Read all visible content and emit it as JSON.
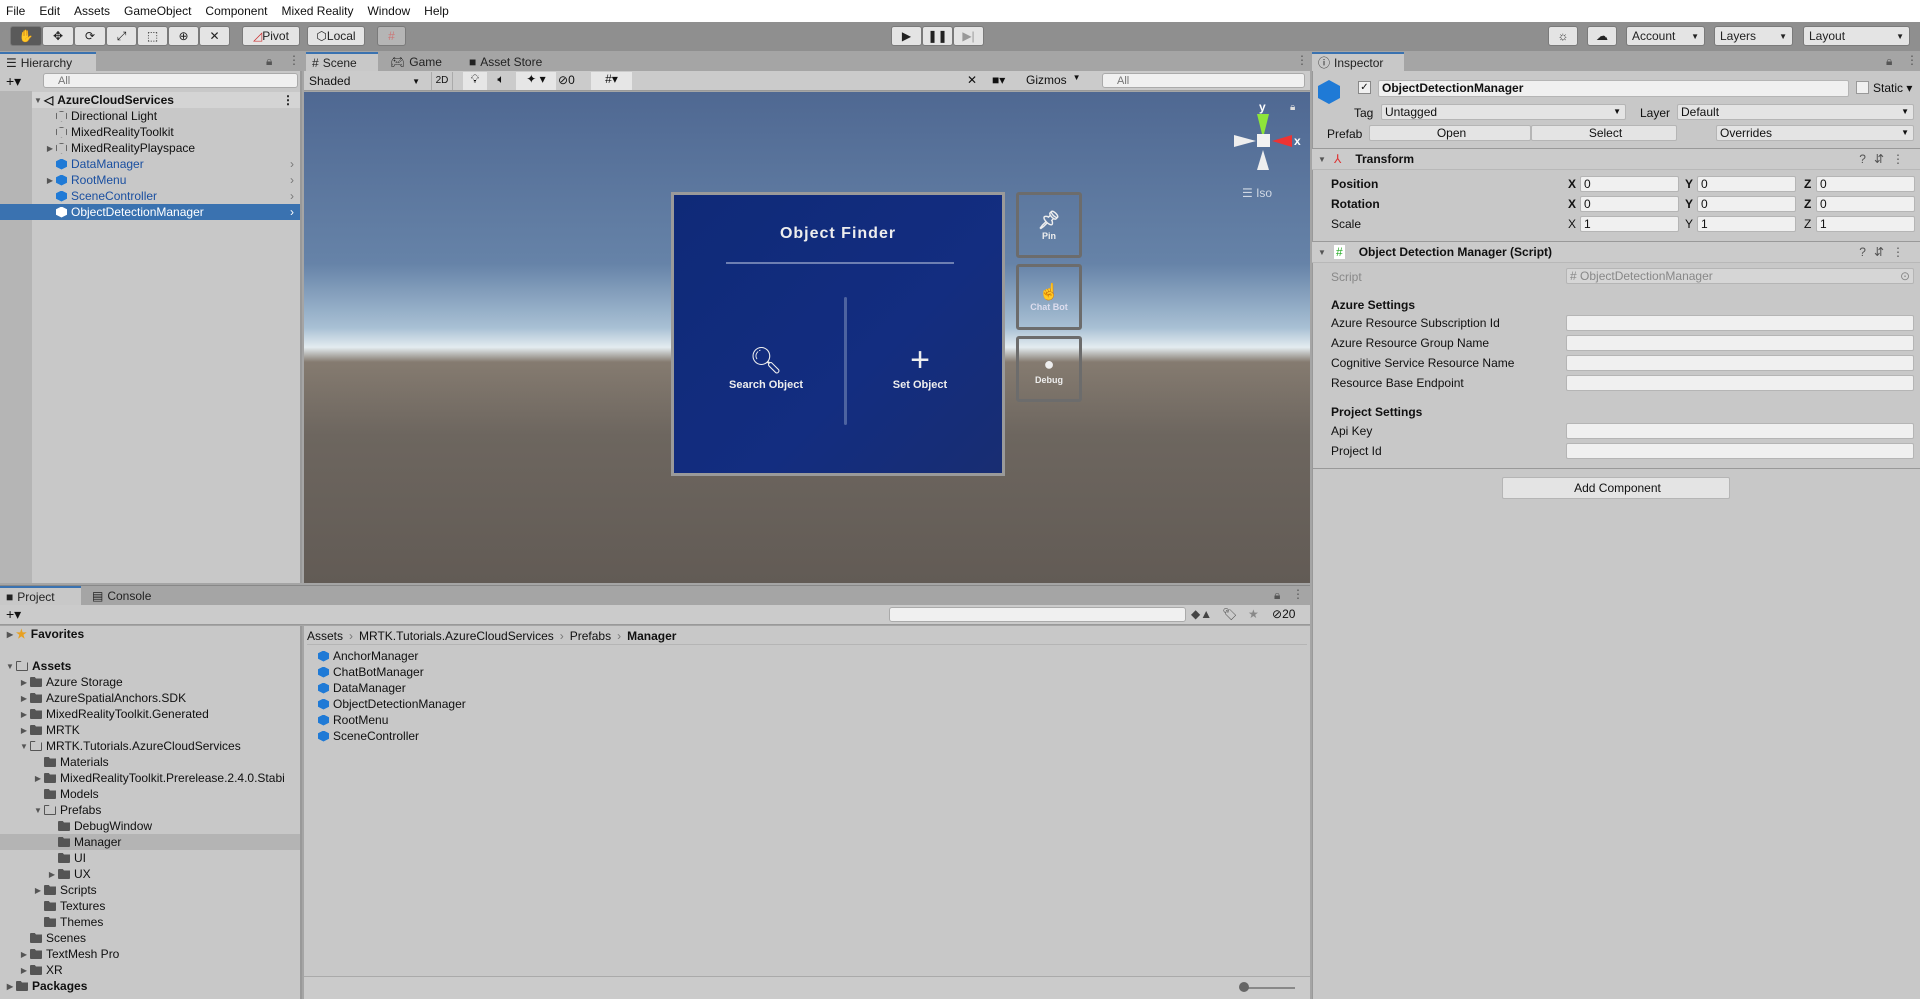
{
  "menu": [
    "File",
    "Edit",
    "Assets",
    "GameObject",
    "Component",
    "Mixed Reality",
    "Window",
    "Help"
  ],
  "toolbar": {
    "pivot": "Pivot",
    "local": "Local",
    "account": "Account",
    "layers": "Layers",
    "layout": "Layout"
  },
  "hierarchy": {
    "tab": "Hierarchy",
    "search_placeholder": "All",
    "scene": "AzureCloudServices",
    "items": [
      {
        "label": "Directional Light",
        "type": "go",
        "expand": false
      },
      {
        "label": "MixedRealityToolkit",
        "type": "go",
        "expand": false
      },
      {
        "label": "MixedRealityPlayspace",
        "type": "go",
        "expand": true
      },
      {
        "label": "DataManager",
        "type": "prefab",
        "expand": false
      },
      {
        "label": "RootMenu",
        "type": "prefab",
        "expand": true
      },
      {
        "label": "SceneController",
        "type": "prefab",
        "expand": false
      },
      {
        "label": "ObjectDetectionManager",
        "type": "prefab",
        "expand": false,
        "selected": true
      }
    ]
  },
  "scene": {
    "tabs": [
      "Scene",
      "Game",
      "Asset Store"
    ],
    "shading": "Shaded",
    "mode2d": "2D",
    "hidden_count": "0",
    "gizmos": "Gizmos",
    "search_placeholder": "All",
    "axis_y": "y",
    "axis_x": "x",
    "projection": "Iso",
    "panel": {
      "title": "Object Finder",
      "search": "Search Object",
      "set": "Set Object"
    },
    "side_buttons": [
      "Pin",
      "Chat Bot",
      "Debug"
    ]
  },
  "inspector": {
    "tab": "Inspector",
    "object_name": "ObjectDetectionManager",
    "static": "Static",
    "tag_label": "Tag",
    "tag": "Untagged",
    "layer_label": "Layer",
    "layer": "Default",
    "prefab_label": "Prefab",
    "open": "Open",
    "select": "Select",
    "overrides": "Overrides",
    "transform": {
      "title": "Transform",
      "rows": [
        {
          "label": "Position",
          "x": "0",
          "y": "0",
          "z": "0"
        },
        {
          "label": "Rotation",
          "x": "0",
          "y": "0",
          "z": "0"
        },
        {
          "label": "Scale",
          "x": "1",
          "y": "1",
          "z": "1"
        }
      ]
    },
    "script_comp": {
      "title": "Object Detection Manager (Script)",
      "script_label": "Script",
      "script_value": "ObjectDetectionManager",
      "azure_header": "Azure Settings",
      "azure_fields": [
        "Azure Resource Subscription Id",
        "Azure Resource Group Name",
        "Cognitive Service Resource Name",
        "Resource Base Endpoint"
      ],
      "project_header": "Project Settings",
      "project_fields": [
        "Api Key",
        "Project Id"
      ]
    },
    "add_component": "Add Component"
  },
  "project": {
    "tabs": [
      "Project",
      "Console"
    ],
    "hidden_count": "20",
    "tree": [
      {
        "label": "Favorites",
        "depth": 0,
        "expand": "r",
        "bold": true,
        "icon": "star"
      },
      {
        "label": "",
        "depth": 0,
        "expand": "",
        "icon": "none"
      },
      {
        "label": "Assets",
        "depth": 0,
        "expand": "d",
        "bold": true,
        "icon": "open"
      },
      {
        "label": "Azure Storage",
        "depth": 1,
        "expand": "r"
      },
      {
        "label": "AzureSpatialAnchors.SDK",
        "depth": 1,
        "expand": "r"
      },
      {
        "label": "MixedRealityToolkit.Generated",
        "depth": 1,
        "expand": "r"
      },
      {
        "label": "MRTK",
        "depth": 1,
        "expand": "r"
      },
      {
        "label": "MRTK.Tutorials.AzureCloudServices",
        "depth": 1,
        "expand": "d",
        "icon": "open"
      },
      {
        "label": "Materials",
        "depth": 2,
        "expand": ""
      },
      {
        "label": "MixedRealityToolkit.Prerelease.2.4.0.Stabi",
        "depth": 2,
        "expand": "r"
      },
      {
        "label": "Models",
        "depth": 2,
        "expand": ""
      },
      {
        "label": "Prefabs",
        "depth": 2,
        "expand": "d",
        "icon": "open"
      },
      {
        "label": "DebugWindow",
        "depth": 3,
        "expand": ""
      },
      {
        "label": "Manager",
        "depth": 3,
        "expand": "",
        "selected": true
      },
      {
        "label": "UI",
        "depth": 3,
        "expand": ""
      },
      {
        "label": "UX",
        "depth": 3,
        "expand": "r"
      },
      {
        "label": "Scripts",
        "depth": 2,
        "expand": "r"
      },
      {
        "label": "Textures",
        "depth": 2,
        "expand": ""
      },
      {
        "label": "Themes",
        "depth": 2,
        "expand": ""
      },
      {
        "label": "Scenes",
        "depth": 1,
        "expand": ""
      },
      {
        "label": "TextMesh Pro",
        "depth": 1,
        "expand": "r"
      },
      {
        "label": "XR",
        "depth": 1,
        "expand": "r"
      },
      {
        "label": "Packages",
        "depth": 0,
        "expand": "r",
        "bold": true
      }
    ],
    "breadcrumb": [
      "Assets",
      "MRTK.Tutorials.AzureCloudServices",
      "Prefabs",
      "Manager"
    ],
    "items": [
      "AnchorManager",
      "ChatBotManager",
      "DataManager",
      "ObjectDetectionManager",
      "RootMenu",
      "SceneController"
    ]
  }
}
